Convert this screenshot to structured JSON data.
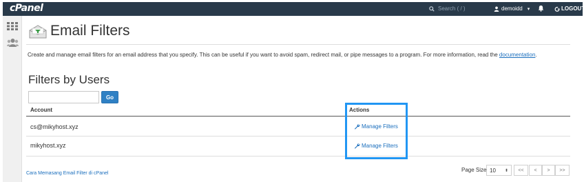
{
  "topbar": {
    "logo": "cPanel",
    "search_placeholder": "Search ( / )",
    "username": "demoidd",
    "logout_label": "LOGOUT"
  },
  "sidebar": {
    "items": [
      {
        "name": "grid-icon"
      },
      {
        "name": "users-icon"
      }
    ]
  },
  "page": {
    "title": "Email Filters",
    "description": "Create and manage email filters for an email address that you specify. This can be useful if you want to avoid spam, redirect mail, or pipe messages to a program. For more information, read the ",
    "doc_link": "documentation",
    "description_end": "."
  },
  "filters": {
    "section_title": "Filters by Users",
    "search_value": "",
    "go_label": "Go",
    "columns": [
      "Account",
      "Actions"
    ],
    "rows": [
      {
        "account": "cs@mikyhost.xyz",
        "action": "Manage Filters"
      },
      {
        "account": "mikyhost.xyz",
        "action": "Manage Filters"
      }
    ]
  },
  "footer": {
    "link": "Cara Memasang Email Filter di cPanel",
    "page_size_label": "Page Size",
    "page_size": "10",
    "pager": [
      "<<",
      "<",
      ">",
      ">>"
    ]
  },
  "colors": {
    "topbar": "#293a4a",
    "accent": "#2f80c4",
    "highlight": "#2196f3",
    "link": "#1a6ebd"
  }
}
